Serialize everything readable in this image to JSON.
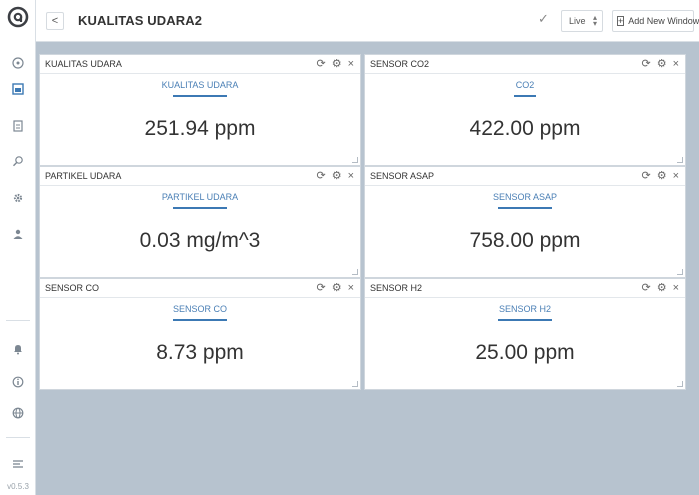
{
  "header": {
    "title": "KUALITAS UDARA2",
    "back_icon": "<",
    "live_label": "Live",
    "add_window_label": "Add New Window"
  },
  "sidebar": {
    "version": "v0.5.3",
    "icons": [
      "logo-icon",
      "dashboard-icon",
      "chart-icon",
      "report-icon",
      "search-icon",
      "gear-icon",
      "users-icon",
      "bell-icon",
      "info-icon",
      "globe-icon",
      "menu-icon"
    ]
  },
  "panels": [
    {
      "title": "KUALITAS UDARA",
      "label": "KUALITAS UDARA",
      "value": "251.94 ppm"
    },
    {
      "title": "SENSOR CO2",
      "label": "CO2",
      "value": "422.00 ppm"
    },
    {
      "title": "PARTIKEL UDARA",
      "label": "PARTIKEL UDARA",
      "value": "0.03 mg/m^3"
    },
    {
      "title": "SENSOR ASAP",
      "label": "SENSOR ASAP",
      "value": "758.00 ppm"
    },
    {
      "title": "SENSOR CO",
      "label": "SENSOR CO",
      "value": "8.73 ppm"
    },
    {
      "title": "SENSOR H2",
      "label": "SENSOR H2",
      "value": "25.00 ppm"
    }
  ],
  "colors": {
    "accent": "#3c79b4",
    "background": "#b7c3cf"
  }
}
